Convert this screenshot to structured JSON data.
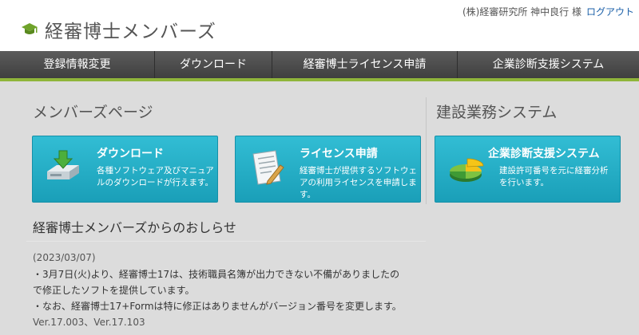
{
  "header": {
    "logo_text": "経審博士メンバーズ",
    "user_name": "(株)経審研究所 神中良行 様",
    "logout_label": "ログアウト"
  },
  "nav": {
    "items": [
      {
        "label": "登録情報変更"
      },
      {
        "label": "ダウンロード"
      },
      {
        "label": "経審博士ライセンス申請"
      },
      {
        "label": "企業診断支援システム"
      }
    ]
  },
  "sections": {
    "members_title": "メンバーズページ",
    "construction_title": "建設業務システム"
  },
  "cards": {
    "download": {
      "title": "ダウンロード",
      "desc_line1": "各種ソフトウェア及びマニュア",
      "desc_line2": "ルのダウンロードが行えます。"
    },
    "license": {
      "title": "ライセンス申請",
      "desc_line1": "経審博士が提供するソフトウェ",
      "desc_line2": "アの利用ライセンスを申請しま",
      "desc_line3": "す。"
    },
    "diagnosis": {
      "title": "企業診断支援システム",
      "desc_line1": "建設許可番号を元に経審分析",
      "desc_line2": "を行います。"
    }
  },
  "news": {
    "title": "経審博士メンバーズからのおしらせ",
    "date": "(2023/03/07)",
    "line1": "・3月7日(火)より、経審博士17は、技術職員名簿が出力できない不備がありましたの",
    "line2": "で修正したソフトを提供しています。",
    "line3": "・なお、経審博士17+Formは特に修正はありませんがバージョン番号を変更します。",
    "versions": "Ver.17.003、Ver.17.103"
  },
  "colors": {
    "nav_accent": "#8fb53a",
    "card_bg": "#1fa8c0",
    "link": "#1a5fa8"
  }
}
